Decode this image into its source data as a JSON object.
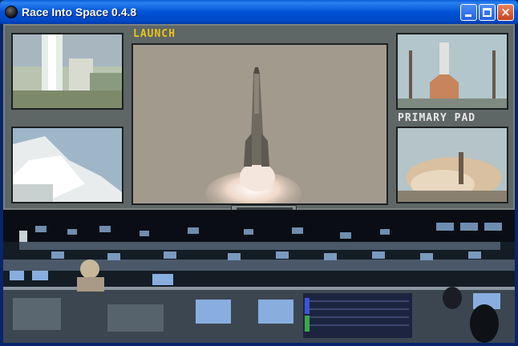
{
  "window": {
    "title": "Race Into Space 0.4.8",
    "minimize_icon": "minimize-icon",
    "maximize_icon": "maximize-icon",
    "close_icon": "close-icon",
    "close_glyph": "×"
  },
  "views": {
    "main_label": "LAUNCH",
    "pad_label": "PRIMARY PAD"
  },
  "playback_controls": {
    "buttons": [
      "rewind-icon",
      "stop-icon",
      "play-icon",
      "fast-forward-icon"
    ]
  },
  "colors": {
    "titlebar": "#0052d6",
    "label_yellow": "#e8c419",
    "label_white": "#e6e6e6",
    "frame": "#5e6666"
  }
}
